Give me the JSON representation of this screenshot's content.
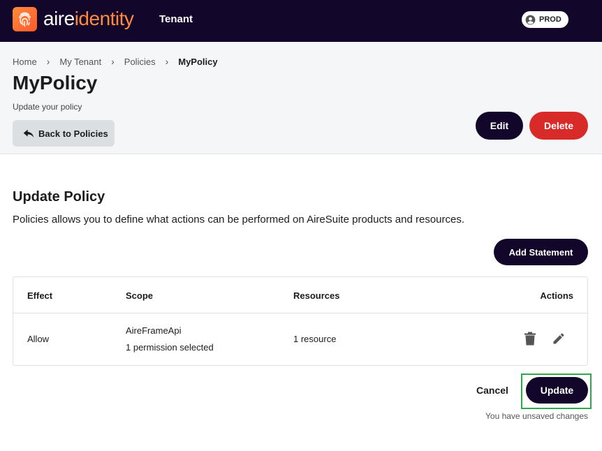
{
  "topbar": {
    "brand_part1": "aire",
    "brand_part2": "identity",
    "tenant_label": "Tenant",
    "env_label": "PROD",
    "colors": {
      "bar": "#13062b",
      "brand_accent": "#ff8a3d"
    },
    "icons": {
      "logo": "fingerprint-icon",
      "env": "user-circle-icon"
    }
  },
  "breadcrumb": [
    {
      "label": "Home"
    },
    {
      "label": "My Tenant"
    },
    {
      "label": "Policies"
    },
    {
      "label": "MyPolicy"
    }
  ],
  "header": {
    "title": "MyPolicy",
    "subtitle": "Update your policy",
    "back_label": "Back to Policies",
    "edit_label": "Edit",
    "delete_label": "Delete",
    "colors": {
      "delete": "#d92a2a",
      "primary": "#13062b"
    }
  },
  "main": {
    "section_title": "Update Policy",
    "section_desc": "Policies allows you to define what actions can be performed on AireSuite products and resources.",
    "add_statement_label": "Add Statement",
    "table": {
      "columns": [
        "Effect",
        "Scope",
        "Resources",
        "Actions"
      ],
      "rows": [
        {
          "effect": "Allow",
          "scope_name": "AireFrameApi",
          "scope_detail": "1 permission selected",
          "resources": "1 resource",
          "actions": [
            "trash-icon",
            "pencil-icon"
          ]
        }
      ]
    },
    "cancel_label": "Cancel",
    "update_label": "Update",
    "unsaved_text": "You have unsaved changes",
    "colors": {
      "highlight": "#2ea84a"
    }
  }
}
